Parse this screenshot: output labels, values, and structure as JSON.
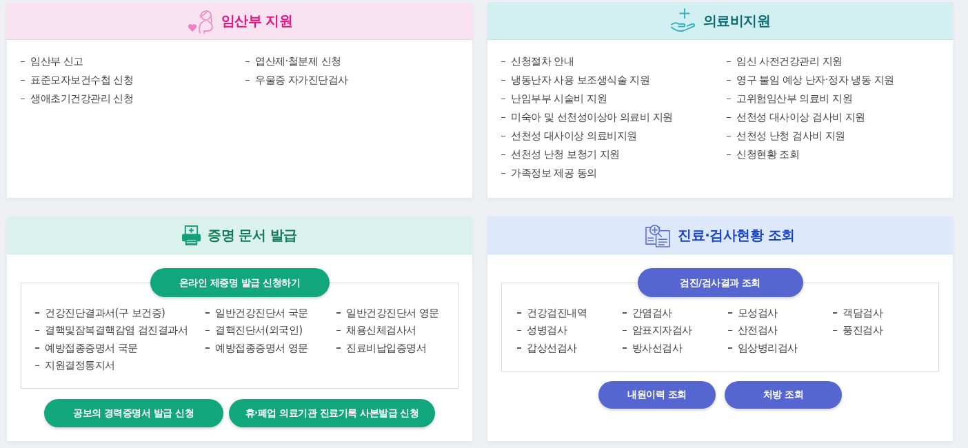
{
  "cards": [
    {
      "kind": "links",
      "title": "임산부 지원",
      "items": [
        "임산부 신고",
        "엽산제·철분제 신청",
        "표준모자보건수첩 신청",
        "우울증 자가진단검사",
        "생애초기건강관리 신청"
      ]
    },
    {
      "kind": "links",
      "title": "의료비지원",
      "items": [
        "신청절차 안내",
        "임신 사전건강관리 지원",
        "냉동난자 사용 보조생식술 지원",
        "영구 불임 예상 난자·정자 냉동 지원",
        "난임부부 시술비 지원",
        "고위험임산부 의료비 지원",
        "미숙아 및 선천성이상아 의료비 지원",
        "선천성 대사이상 검사비 지원",
        "선천성 대사이상 의료비지원",
        "선천성 난청 검사비 지원",
        "선천성 난청 보청기 지원",
        "신청현황 조회",
        "가족정보 제공 동의"
      ]
    },
    {
      "kind": "panel",
      "title": "증명 문서 발급",
      "main_button": "온라인 제증명 발급 신청하기",
      "items": [
        "건강진단결과서(구 보건증)",
        "일반건강진단서 국문",
        "일반건강진단서 영문",
        "결핵및잠복결핵감염 검진결과서",
        "결핵진단서(외국인)",
        "채용신체검사서",
        "예방접종증명서 국문",
        "예방접종증명서 영문",
        "진료비납입증명서",
        "지원결정통지서"
      ],
      "buttons": [
        "공보의 경력증명서 발급 신청",
        "휴·폐업 의료기관 진료기록 사본발급 신청"
      ]
    },
    {
      "kind": "panel",
      "title": "진료·검사현황 조회",
      "main_button": "검진/검사결과 조회",
      "items": [
        "건강검진내역",
        "간염검사",
        "모성검사",
        "객담검사",
        "성병검사",
        "암표지자검사",
        "산전검사",
        "풍진검사",
        "갑상선검사",
        "방사선검사",
        "임상병리검사"
      ],
      "buttons": [
        "내원이력 조회",
        "처방 조회"
      ]
    }
  ]
}
